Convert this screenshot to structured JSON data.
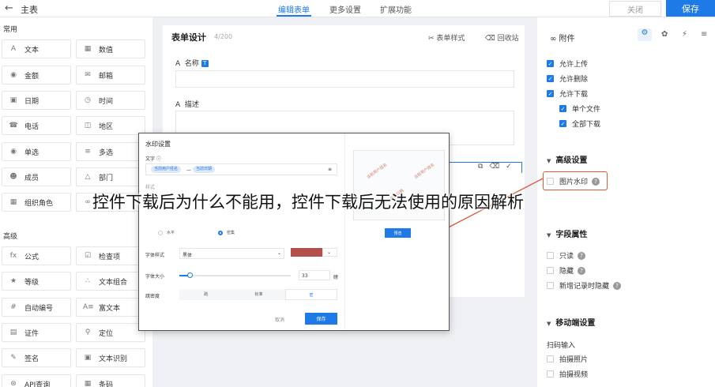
{
  "header": {
    "back_icon": "arrow-left-icon",
    "title": "主表",
    "tabs": [
      {
        "label": "编辑表单",
        "active": true
      },
      {
        "label": "更多设置",
        "active": false
      },
      {
        "label": "扩展功能",
        "active": false
      }
    ],
    "close_label": "关闭",
    "save_label": "保存"
  },
  "left_panel": {
    "common_title": "常用",
    "common_items": [
      {
        "label": "文本",
        "icon": "text-icon"
      },
      {
        "label": "数值",
        "icon": "number-icon"
      },
      {
        "label": "金额",
        "icon": "money-icon"
      },
      {
        "label": "邮箱",
        "icon": "mail-icon"
      },
      {
        "label": "日期",
        "icon": "calendar-icon"
      },
      {
        "label": "时间",
        "icon": "clock-icon"
      },
      {
        "label": "电话",
        "icon": "phone-icon"
      },
      {
        "label": "地区",
        "icon": "region-icon"
      },
      {
        "label": "单选",
        "icon": "radio-icon"
      },
      {
        "label": "多选",
        "icon": "checkbox-icon"
      },
      {
        "label": "成员",
        "icon": "member-icon"
      },
      {
        "label": "部门",
        "icon": "department-icon"
      },
      {
        "label": "组织角色",
        "icon": "role-icon"
      }
    ],
    "advanced_title": "高级",
    "advanced_items": [
      {
        "label": "公式",
        "icon": "formula-icon"
      },
      {
        "label": "检查项",
        "icon": "check-item-icon"
      },
      {
        "label": "等级",
        "icon": "star-icon"
      },
      {
        "label": "文本组合",
        "icon": "text-combine-icon"
      },
      {
        "label": "自动编号",
        "icon": "hash-icon"
      },
      {
        "label": "富文本",
        "icon": "rich-text-icon"
      },
      {
        "label": "证件",
        "icon": "id-card-icon"
      },
      {
        "label": "定位",
        "icon": "location-icon"
      },
      {
        "label": "签名",
        "icon": "signature-icon"
      },
      {
        "label": "文本识别",
        "icon": "ocr-icon"
      },
      {
        "label": "API查询",
        "icon": "api-icon"
      },
      {
        "label": "条码",
        "icon": "barcode-icon"
      }
    ]
  },
  "canvas": {
    "title": "表单设计",
    "count": "4/200",
    "style_action": "表单样式",
    "recycle_action": "回收站",
    "fields": [
      {
        "label": "名称"
      },
      {
        "label": "描述"
      }
    ]
  },
  "dialog": {
    "title": "水印设置",
    "text_label": "文字",
    "chips": [
      "当前用户姓名",
      "当前日期"
    ],
    "chip_sep": "—",
    "style_label": "样式",
    "radio_horizontal": "水平",
    "radio_dense": "密集",
    "font_style_label": "字体样式",
    "font_value": "黑体",
    "font_size_label": "字体大小",
    "font_size_value": "33",
    "font_size_unit": "磅",
    "font_size_fraction": 0.09,
    "density_label": "疏密度",
    "density_options": [
      "疏",
      "标准",
      "密"
    ],
    "density_selected": 2,
    "cancel_label": "取消",
    "save_label": "保存",
    "preview_label": "预览",
    "watermark_color": "#b3504c"
  },
  "right_panel": {
    "title": "附件",
    "tab_icons": [
      "link-icon",
      "gear-icon",
      "palette-icon",
      "bolt-icon",
      "sort-icon"
    ],
    "checkboxes": [
      {
        "label": "允许上传",
        "checked": true
      },
      {
        "label": "允许删除",
        "checked": true
      },
      {
        "label": "允许下载",
        "checked": true
      },
      {
        "label": "单个文件",
        "checked": true
      },
      {
        "label": "全部下载",
        "checked": true
      }
    ],
    "advanced_title": "高级设置",
    "watermark_label": "图片水印",
    "field_props_title": "字段属性",
    "readonly_label": "只读",
    "hidden_label": "隐藏",
    "hide_new_label": "新增记录时隐藏",
    "mobile_title": "移动端设置",
    "scan_label": "扫码输入",
    "photo_label": "拍摄照片",
    "video_label": "拍摄视频"
  },
  "overlay_caption": "控件下载后为什么不能用，控件下载后无法使用的原因解析",
  "accent_color": "#1e7ae6",
  "highlight_color": "#e0593b"
}
